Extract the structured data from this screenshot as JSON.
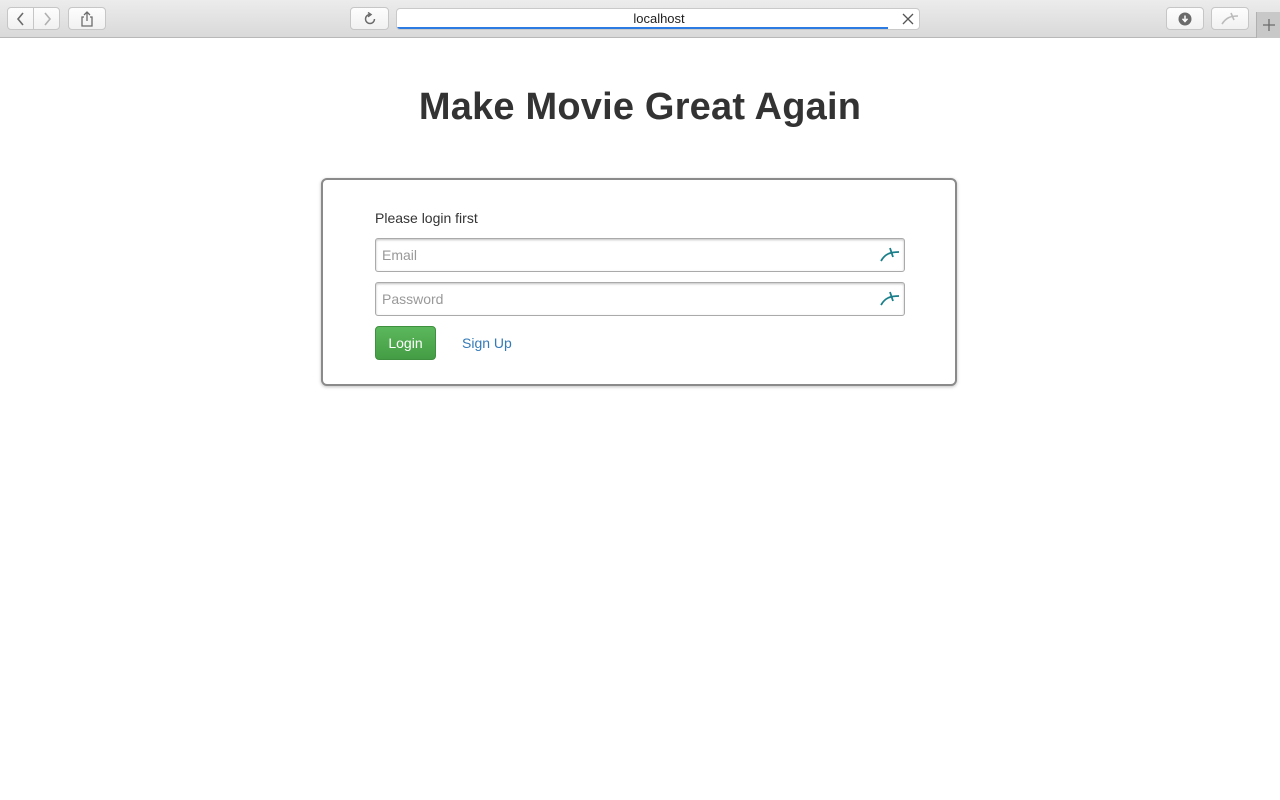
{
  "browser": {
    "url": "localhost",
    "load_progress": 0.94,
    "accent_color": "#2b7be3"
  },
  "icons": {
    "back": "chevron-left-icon",
    "forward": "chevron-right-icon",
    "share": "share-icon",
    "reload": "reload-icon",
    "stop": "close-icon",
    "downloads": "download-icon",
    "extension": "password-key-icon",
    "new_tab": "plus-icon"
  },
  "page": {
    "title": "Make Movie Great Again"
  },
  "login_form": {
    "prompt": "Please login first",
    "email_placeholder": "Email",
    "email_value": "",
    "password_placeholder": "Password",
    "password_value": "",
    "login_label": "Login",
    "signup_label": "Sign Up",
    "login_color": "#5cb85c",
    "link_color": "#337ab7"
  }
}
